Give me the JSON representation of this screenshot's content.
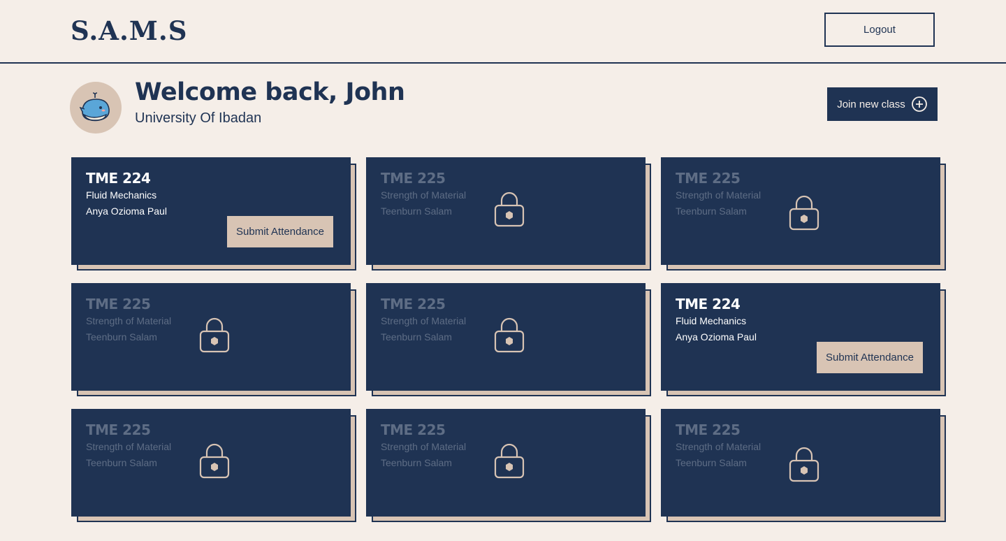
{
  "app": {
    "logo": "S.A.M.S",
    "logout_label": "Logout"
  },
  "profile": {
    "welcome": "Welcome back, John",
    "school": "University Of Ibadan",
    "avatar_icon": "whale-icon"
  },
  "join_button": {
    "label": "Join new class",
    "icon": "plus-circle-icon"
  },
  "colors": {
    "background": "#f5eee8",
    "navy": "#1f3353",
    "tan": "#d8c4b4",
    "muted": "#5e6d85"
  },
  "classes": [
    {
      "code": "TME 224",
      "subject": "Fluid Mechanics",
      "lecturer": "Anya Ozioma Paul",
      "locked": false,
      "action": "Submit Attendance"
    },
    {
      "code": "TME 225",
      "subject": "Strength of Material",
      "lecturer": "Teenburn Salam",
      "locked": true
    },
    {
      "code": "TME 225",
      "subject": "Strength of Material",
      "lecturer": "Teenburn Salam",
      "locked": true
    },
    {
      "code": "TME 225",
      "subject": "Strength of Material",
      "lecturer": "Teenburn Salam",
      "locked": true
    },
    {
      "code": "TME 225",
      "subject": "Strength of Material",
      "lecturer": "Teenburn Salam",
      "locked": true
    },
    {
      "code": "TME 224",
      "subject": "Fluid Mechanics",
      "lecturer": "Anya Ozioma Paul",
      "locked": false,
      "action": "Submit Attendance"
    },
    {
      "code": "TME 225",
      "subject": "Strength of Material",
      "lecturer": "Teenburn Salam",
      "locked": true
    },
    {
      "code": "TME 225",
      "subject": "Strength of Material",
      "lecturer": "Teenburn Salam",
      "locked": true
    },
    {
      "code": "TME 225",
      "subject": "Strength of Material",
      "lecturer": "Teenburn Salam",
      "locked": true
    }
  ]
}
